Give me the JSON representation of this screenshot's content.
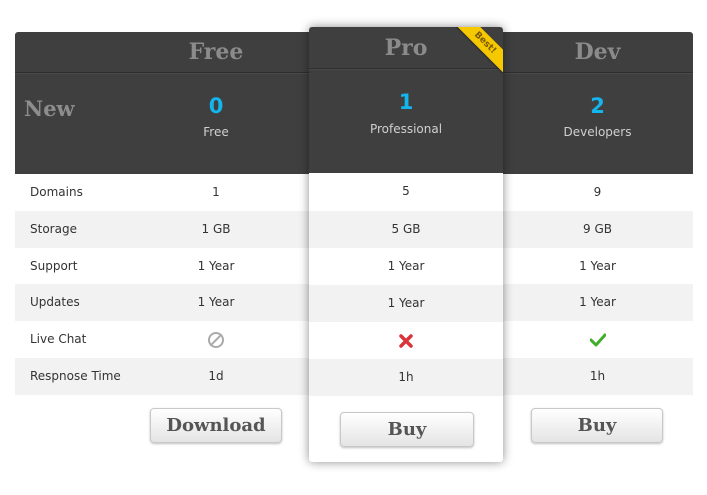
{
  "header": {
    "new_label": "New",
    "plans": [
      {
        "name": "Free",
        "number": "0",
        "sub": "Free"
      },
      {
        "name": "Pro",
        "number": "1",
        "sub": "Professional",
        "badge": "Best!"
      },
      {
        "name": "Dev",
        "number": "2",
        "sub": "Developers"
      }
    ]
  },
  "features": [
    {
      "label": "Domains",
      "values": [
        "1",
        "5",
        "9"
      ]
    },
    {
      "label": "Storage",
      "values": [
        "1 GB",
        "5 GB",
        "9 GB"
      ]
    },
    {
      "label": "Support",
      "values": [
        "1 Year",
        "1 Year",
        "1 Year"
      ]
    },
    {
      "label": "Updates",
      "values": [
        "1 Year",
        "1 Year",
        "1 Year"
      ]
    },
    {
      "label": "Live Chat",
      "values": [
        "not-available-icon",
        "cross-icon",
        "check-icon"
      ]
    },
    {
      "label": "Respnose Time",
      "values": [
        "1d",
        "1h",
        "1h"
      ]
    }
  ],
  "buttons": {
    "free": "Download",
    "pro": "Buy",
    "dev": "Buy"
  },
  "colors": {
    "header_bg": "#3f3f3f",
    "accent_number": "#14b5ec",
    "badge": "#f6c800",
    "cross": "#d9343a",
    "check": "#3fae2a"
  }
}
